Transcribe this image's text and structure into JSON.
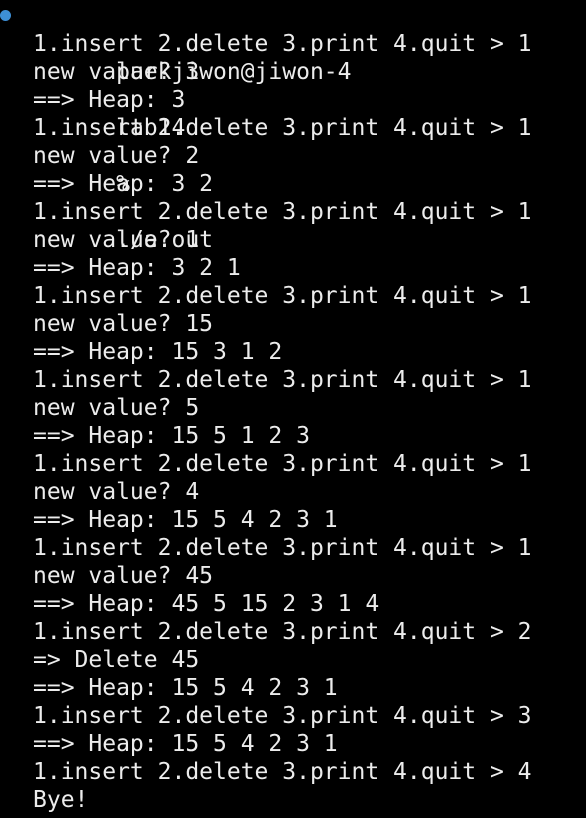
{
  "colors": {
    "background": "#000000",
    "text": "#ececec",
    "prompt_dot": "#3d8fd6"
  },
  "prompt": {
    "user_host": "parkjiwon@jiwon-4",
    "directory": "lab14",
    "symbol": "%",
    "command": "./a.out"
  },
  "output_lines": [
    "1.insert 2.delete 3.print 4.quit > 1",
    "new value? 3",
    "==> Heap: 3",
    "1.insert 2.delete 3.print 4.quit > 1",
    "new value? 2",
    "==> Heap: 3 2",
    "1.insert 2.delete 3.print 4.quit > 1",
    "new value? 1",
    "==> Heap: 3 2 1",
    "1.insert 2.delete 3.print 4.quit > 1",
    "new value? 15",
    "==> Heap: 15 3 1 2",
    "1.insert 2.delete 3.print 4.quit > 1",
    "new value? 5",
    "==> Heap: 15 5 1 2 3",
    "1.insert 2.delete 3.print 4.quit > 1",
    "new value? 4",
    "==> Heap: 15 5 4 2 3 1",
    "1.insert 2.delete 3.print 4.quit > 1",
    "new value? 45",
    "==> Heap: 45 5 15 2 3 1 4",
    "1.insert 2.delete 3.print 4.quit > 2",
    "=> Delete 45",
    "==> Heap: 15 5 4 2 3 1",
    "1.insert 2.delete 3.print 4.quit > 3",
    "==> Heap: 15 5 4 2 3 1",
    "1.insert 2.delete 3.print 4.quit > 4",
    "Bye!"
  ]
}
